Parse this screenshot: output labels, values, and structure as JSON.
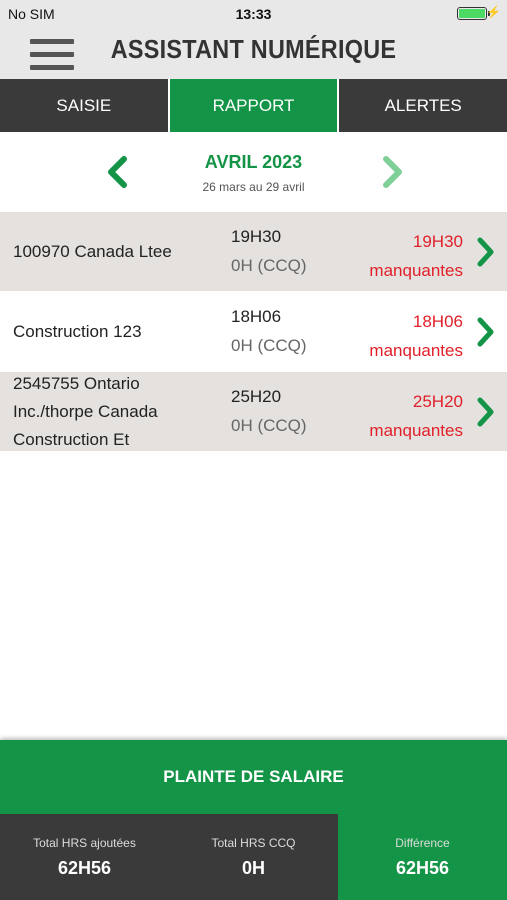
{
  "status_bar": {
    "carrier": "No SIM",
    "time": "13:33"
  },
  "header": {
    "title": "ASSISTANT NUMÉRIQUE"
  },
  "tabs": [
    {
      "label": "SAISIE",
      "active": false
    },
    {
      "label": "RAPPORT",
      "active": true
    },
    {
      "label": "ALERTES",
      "active": false
    }
  ],
  "period": {
    "month": "AVRIL 2023",
    "range": "26 mars au 29 avril"
  },
  "rows": [
    {
      "company": "100970 Canada Ltee",
      "hours": "19H30",
      "ccq": "0H (CCQ)",
      "missing_hours": "19H30",
      "missing_label": "manquantes"
    },
    {
      "company": "Construction 123",
      "hours": "18H06",
      "ccq": "0H (CCQ)",
      "missing_hours": "18H06",
      "missing_label": "manquantes"
    },
    {
      "company": "2545755 Ontario Inc./thorpe Canada Construction Et",
      "hours": "25H20",
      "ccq": "0H (CCQ)",
      "missing_hours": "25H20",
      "missing_label": "manquantes"
    }
  ],
  "complaint_button": "PLAINTE DE SALAIRE",
  "totals": {
    "added_label": "Total HRS ajoutées",
    "added_value": "62H56",
    "ccq_label": "Total HRS CCQ",
    "ccq_value": "0H",
    "diff_label": "Différence",
    "diff_value": "62H56"
  },
  "colors": {
    "accent_green": "#149447",
    "missing_red": "#e2202a",
    "dark_tab": "#3a3a3a"
  }
}
